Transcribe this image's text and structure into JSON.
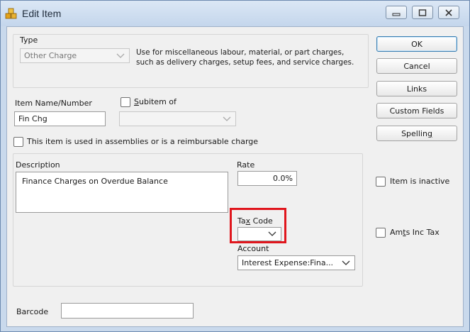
{
  "window": {
    "title": "Edit Item"
  },
  "type_section": {
    "legend": "Type",
    "selected": "Other Charge",
    "description": "Use for miscellaneous labour, material, or part charges, such as delivery charges, setup fees, and service charges."
  },
  "item_name": {
    "label": "Item Name/Number",
    "value": "Fin Chg"
  },
  "subitem": {
    "label_underlined": "S",
    "label_rest": "ubitem of",
    "checked": false,
    "value": ""
  },
  "assemblies": {
    "label": "This item is used in assemblies or is a reimbursable charge",
    "checked": false
  },
  "description": {
    "label": "Description",
    "value": "Finance Charges on Overdue Balance"
  },
  "rate": {
    "label": "Rate",
    "value": "0.0%"
  },
  "tax_code": {
    "label_pre": "Ta",
    "label_underlined": "x",
    "label_post": " Code",
    "value": ""
  },
  "account": {
    "label": "Account",
    "value": "Interest Expense:Fina..."
  },
  "barcode": {
    "label": "Barcode",
    "value": ""
  },
  "buttons": {
    "ok": "OK",
    "cancel": "Cancel",
    "links": "Links",
    "custom_fields": "Custom Fields",
    "spelling_pre": "Spellin",
    "spelling_underlined": "g"
  },
  "item_inactive": {
    "label": "Item is inactive",
    "checked": false
  },
  "amts_inc_tax": {
    "label_pre": "Am",
    "label_underlined": "t",
    "label_post": "s Inc Tax",
    "checked": false
  },
  "colors": {
    "highlight": "#e0161d",
    "default_button_border": "#3c7fb1"
  },
  "icons": {
    "app": "boxes-icon",
    "dropdown": "chevron-down-icon"
  }
}
